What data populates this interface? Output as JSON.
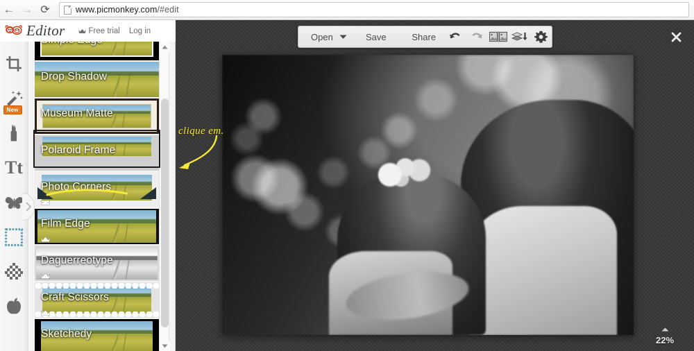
{
  "browser": {
    "back_icon": "arrow-left-icon",
    "forward_icon": "arrow-right-icon",
    "reload_icon": "reload-icon",
    "url_prefix": "www.picmonkey.com",
    "url_suffix": "/#edit",
    "url_full": "www.picmonkey.com/#edit"
  },
  "header": {
    "brand": "Editor",
    "logo_icon": "monkey-logo-icon",
    "links": [
      {
        "label": "Free trial",
        "icon": "crown-icon"
      },
      {
        "label": "Log in",
        "icon": ""
      }
    ]
  },
  "rail": {
    "items": [
      {
        "name": "crop",
        "icon": "crop-icon",
        "label": "Crop",
        "badge": "",
        "active": false
      },
      {
        "name": "touch-up-magic",
        "icon": "magic-wand-icon",
        "label": "Effects",
        "badge": "New",
        "active": false
      },
      {
        "name": "touch-up",
        "icon": "lipstick-icon",
        "label": "Touch Up",
        "badge": "",
        "active": false
      },
      {
        "name": "text",
        "icon": "text-tt-icon",
        "label": "Text",
        "badge": "",
        "active": false
      },
      {
        "name": "overlays",
        "icon": "butterfly-icon",
        "label": "Overlays",
        "badge": "",
        "active": false
      },
      {
        "name": "frames",
        "icon": "frame-icon",
        "label": "Frames",
        "badge": "",
        "active": true
      },
      {
        "name": "textures",
        "icon": "texture-icon",
        "label": "Textures",
        "badge": "",
        "active": false
      },
      {
        "name": "themes",
        "icon": "apple-icon",
        "label": "Themes",
        "badge": "",
        "active": false
      }
    ],
    "collapse_icon": "chevron-right-icon",
    "badge_color": "#e8761a",
    "active_color": "#5b9bb0"
  },
  "panel": {
    "effects": [
      {
        "label": "Simple Edge",
        "style": "fx-simple-edge",
        "premium": false,
        "selected": false
      },
      {
        "label": "Drop Shadow",
        "style": "fx-drop-shadow",
        "premium": false,
        "selected": false
      },
      {
        "label": "Museum Matte",
        "style": "fx-museum-matte",
        "premium": false,
        "selected": true
      },
      {
        "label": "Polaroid Frame",
        "style": "fx-polaroid",
        "premium": false,
        "selected": false
      },
      {
        "label": "Photo Corners",
        "style": "fx-corners",
        "premium": true,
        "selected": false
      },
      {
        "label": "Film Edge",
        "style": "fx-film-edge",
        "premium": true,
        "selected": false
      },
      {
        "label": "Daguerreotype",
        "style": "fx-daguerre",
        "premium": true,
        "selected": false
      },
      {
        "label": "Craft Scissors",
        "style": "fx-craft",
        "premium": true,
        "selected": false
      },
      {
        "label": "Sketchedy",
        "style": "fx-sketchedy",
        "premium": false,
        "selected": false
      }
    ],
    "scrollbar": {
      "up_icon": "scroll-up-arrow-icon",
      "down_icon": "scroll-down-arrow-icon"
    }
  },
  "toolbar": {
    "open_label": "Open",
    "open_caret_icon": "chevron-down-icon",
    "save_label": "Save",
    "share_label": "Share",
    "undo_icon": "undo-icon",
    "redo_icon": "redo-icon",
    "compare_icon": "before-after-images-icon",
    "layers_icon": "layers-download-icon",
    "settings_icon": "gear-icon",
    "close_icon": "close-x-icon"
  },
  "canvas": {
    "zoom_level": "22%",
    "zoom_caret_icon": "chevron-up-icon",
    "photo_alt": "black-and-white-couple-photo"
  },
  "annotations": {
    "note_text": "clique em.",
    "note_color": "#f5e83a",
    "arrow_icon": "curved-arrow-icon",
    "underline_icon": "highlight-underline-icon"
  }
}
